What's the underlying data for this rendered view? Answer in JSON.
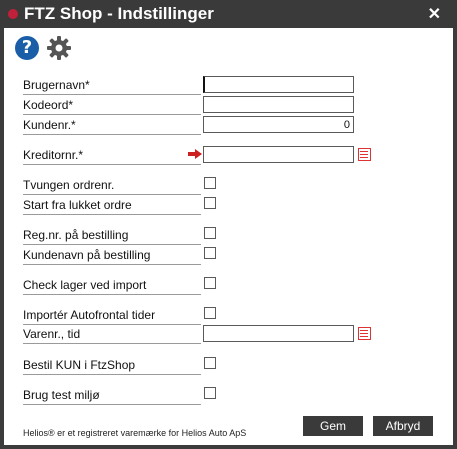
{
  "window": {
    "title": "FTZ Shop - Indstillinger",
    "close_glyph": "✕"
  },
  "toolbar": {
    "help_glyph": "?",
    "icons": [
      "help-icon",
      "gear-icon"
    ]
  },
  "fields": {
    "brugernavn": {
      "label": "Brugernavn*",
      "value": ""
    },
    "kodeord": {
      "label": "Kodeord*",
      "value": ""
    },
    "kundenr": {
      "label": "Kundenr.*",
      "value": "0"
    },
    "kreditornr": {
      "label": "Kreditornr.*",
      "value": ""
    },
    "tvungen": {
      "label": "Tvungen ordrenr.",
      "checked": false
    },
    "start_lukket": {
      "label": "Start fra lukket ordre",
      "checked": false
    },
    "regnr": {
      "label": "Reg.nr. på bestilling",
      "checked": false
    },
    "kundenavn": {
      "label": "Kundenavn på bestilling",
      "checked": false
    },
    "check_lager": {
      "label": "Check lager ved import",
      "checked": false
    },
    "autofrontal": {
      "label": "Importér Autofrontal tider",
      "checked": false
    },
    "varenr_tid": {
      "label": "Varenr., tid",
      "value": ""
    },
    "kun_ftzshop": {
      "label": "Bestil KUN i FtzShop",
      "checked": false
    },
    "test_miljo": {
      "label": "Brug test miljø",
      "checked": false
    }
  },
  "footer": {
    "trademark": "Helios® er et registreret varemærke for Helios Auto ApS",
    "save_label": "Gem",
    "cancel_label": "Afbryd"
  },
  "colors": {
    "title_dot": "#c0203a",
    "help_icon": "#1a5ea8",
    "list_icon": "#dd3333",
    "arrow_icon": "#cc1f1f"
  }
}
